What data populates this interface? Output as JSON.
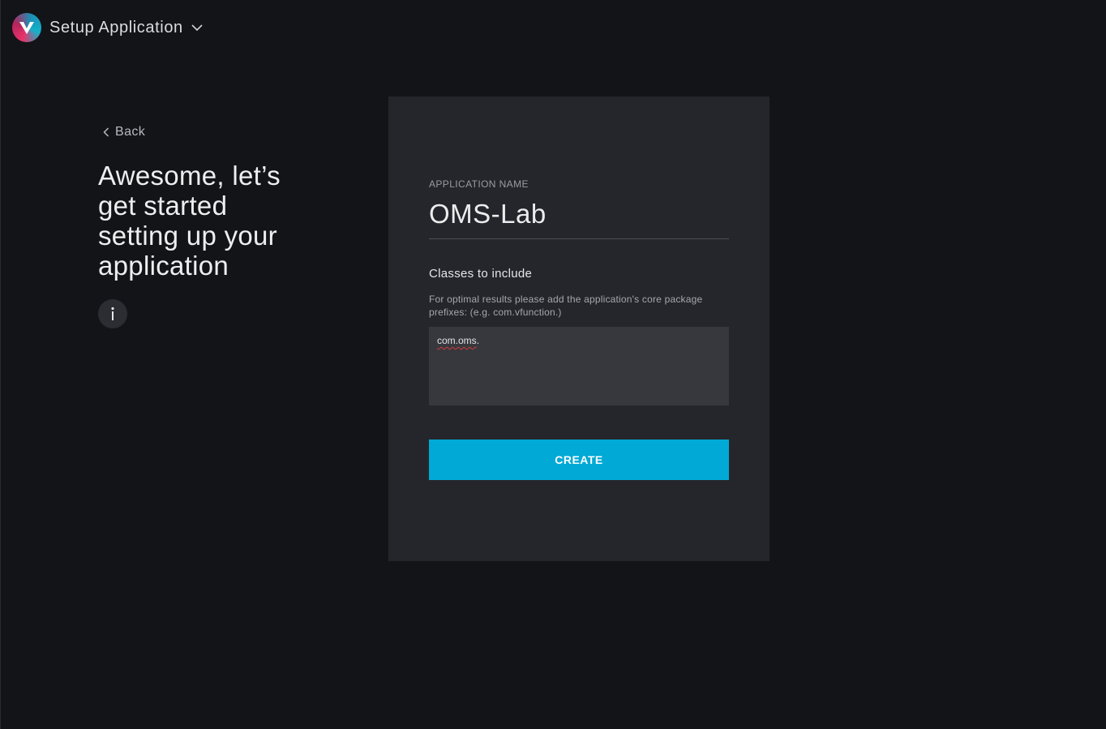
{
  "header": {
    "title": "Setup Application",
    "logo_letter": "V",
    "dropdown_icon": "chevron-down-icon"
  },
  "left": {
    "back_label": "Back",
    "hero_title": "Awesome, let’s get started setting up your application",
    "info_icon": "info-icon"
  },
  "form": {
    "name_label": "APPLICATION NAME",
    "name_value": "OMS-Lab",
    "classes_title": "Classes to include",
    "classes_help": "For optimal results please add the application's core package prefixes: (e.g. com.vfunction.)",
    "classes_misspelled": "com.oms",
    "classes_rest": ".",
    "create_label": "CREATE"
  },
  "colors": {
    "background": "#131418",
    "card": "#25262b",
    "input": "#37383e",
    "accent": "#00a9d6"
  }
}
